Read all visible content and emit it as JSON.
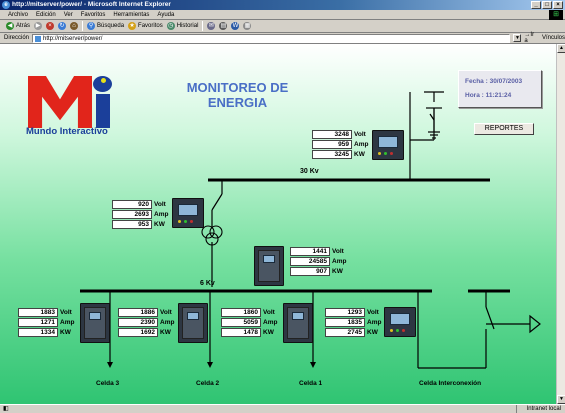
{
  "window": {
    "title": "http://mitserver/power/ - Microsoft Internet Explorer"
  },
  "menu": [
    "Archivo",
    "Edición",
    "Ver",
    "Favoritos",
    "Herramientas",
    "Ayuda"
  ],
  "toolbar": {
    "back": "Atrás",
    "search": "Búsqueda",
    "favorites": "Favoritos",
    "history": "Historial"
  },
  "address": {
    "label": "Dirección",
    "url": "http://mitserver/power/",
    "go": "Ir a",
    "links": "Vínculos"
  },
  "logo": {
    "caption": "Mundo Interactivo"
  },
  "page": {
    "title_line1": "MONITOREO DE",
    "title_line2": "ENERGIA"
  },
  "datetime": {
    "fecha_label": "Fecha :",
    "fecha": "30/07/2003",
    "hora_label": "Hora :",
    "hora": "11:21:24"
  },
  "reportes": "REPORTES",
  "bus": {
    "kv30": "30 Kv",
    "kv6": "6 Kv"
  },
  "meters": {
    "main30": {
      "volt": "3248",
      "amp": "959",
      "kw": "3245"
    },
    "trafo_hv": {
      "volt": "920",
      "amp": "2693",
      "kw": "953"
    },
    "trafo_lv": {
      "volt": "1441",
      "amp": "24585",
      "kw": "907"
    },
    "celda3": {
      "volt": "1883",
      "amp": "1271",
      "kw": "1334"
    },
    "celda2": {
      "volt": "1886",
      "amp": "2390",
      "kw": "1692"
    },
    "celda1": {
      "volt": "1860",
      "amp": "5059",
      "kw": "1478"
    },
    "interconexion": {
      "volt": "1293",
      "amp": "1835",
      "kw": "2745"
    }
  },
  "units": {
    "volt": "Volt",
    "amp": "Amp",
    "kw": "KW"
  },
  "cells": {
    "c3": "Celda 3",
    "c2": "Celda 2",
    "c1": "Celda 1",
    "ci": "Celda Interconexión"
  },
  "status": {
    "left": "",
    "zone": "Intranet local"
  },
  "colors": {
    "title_blue": "#4a6fc6",
    "logo_red": "#e1251b",
    "logo_blue": "#1b3f9a",
    "bg_green": "#2fc472"
  }
}
